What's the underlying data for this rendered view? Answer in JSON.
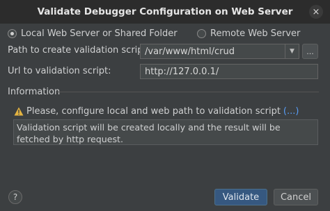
{
  "window": {
    "title": "Validate Debugger Configuration on Web Server",
    "close_symbol": "×"
  },
  "mode": {
    "local_label": "Local Web Server or Shared Folder",
    "remote_label": "Remote Web Server",
    "selected": "local"
  },
  "form": {
    "path_label": "Path to create validation script:",
    "path_value": "/var/www/html/crud",
    "browse_label": "...",
    "url_label": "Url to validation script:",
    "url_value": "http://127.0.0.1/"
  },
  "information": {
    "heading": "Information",
    "warning_text": "Please, configure local and web path to validation script",
    "more_link": "(...)",
    "description": "Validation script will be created locally and the result will be fetched by http request."
  },
  "footer": {
    "help_symbol": "?",
    "validate_label": "Validate",
    "cancel_label": "Cancel"
  },
  "icons": {
    "close": "close-icon",
    "warning": "warning-icon",
    "dropdown": "chevron-down-icon",
    "help": "help-icon"
  }
}
